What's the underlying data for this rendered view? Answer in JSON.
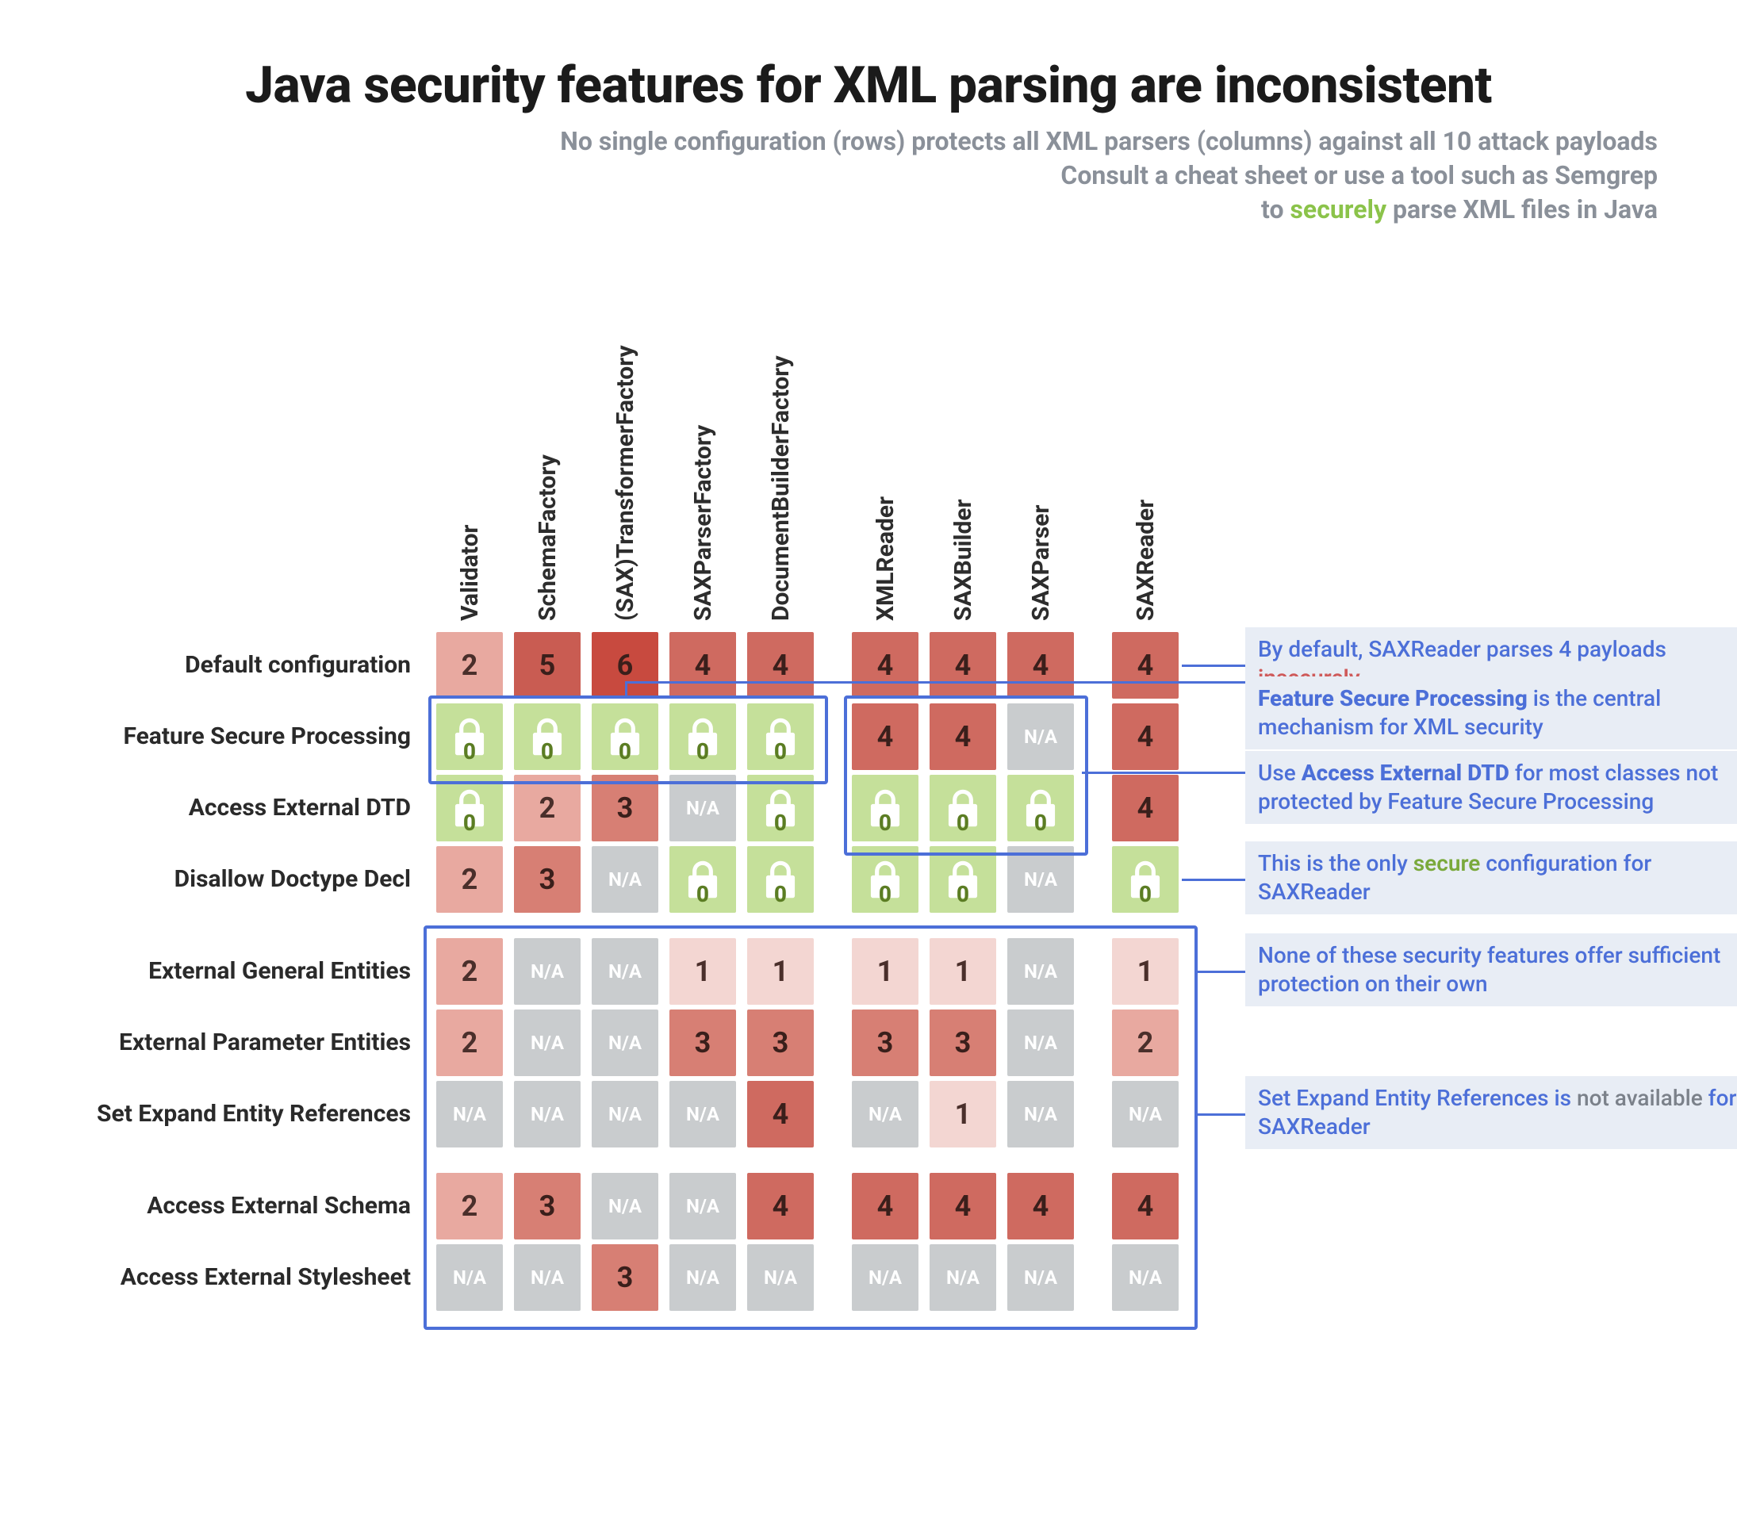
{
  "title": "Java security features for XML parsing are inconsistent",
  "subtitle_line1": "No single configuration (rows) protects all XML parsers (columns) against all 10 attack payloads",
  "subtitle_line2a": "Consult a cheat sheet or use a tool such as Semgrep",
  "subtitle_line3_pre": "to ",
  "subtitle_line3_sec": "securely",
  "subtitle_line3_post": " parse XML files in Java",
  "columns": [
    "Validator",
    "SchemaFactory",
    "(SAX)TransformerFactory",
    "SAXParserFactory",
    "DocumentBuilderFactory",
    "XMLReader",
    "SAXBuilder",
    "SAXParser",
    "SAXReader"
  ],
  "rows": [
    {
      "label": "Default configuration",
      "cells": [
        "2",
        "5",
        "6",
        "4",
        "4",
        "4",
        "4",
        "4",
        "4"
      ],
      "space_after": false
    },
    {
      "label": "Feature Secure Processing",
      "cells": [
        "lock",
        "lock",
        "lock",
        "lock",
        "lock",
        "4",
        "4",
        "N/A",
        "4"
      ],
      "space_after": false
    },
    {
      "label": "Access External DTD",
      "cells": [
        "lock",
        "2",
        "3",
        "N/A",
        "lock",
        "lock",
        "lock",
        "lock",
        "4"
      ],
      "space_after": false
    },
    {
      "label": "Disallow Doctype Decl",
      "cells": [
        "2",
        "3",
        "N/A",
        "lock",
        "lock",
        "lock",
        "lock",
        "N/A",
        "lock"
      ],
      "space_after": true
    },
    {
      "label": "External General Entities",
      "cells": [
        "2",
        "N/A",
        "N/A",
        "1",
        "1",
        "1",
        "1",
        "N/A",
        "1"
      ],
      "space_after": false
    },
    {
      "label": "External Parameter Entities",
      "cells": [
        "2",
        "N/A",
        "N/A",
        "3",
        "3",
        "3",
        "3",
        "N/A",
        "2"
      ],
      "space_after": false
    },
    {
      "label": "Set Expand Entity References",
      "cells": [
        "N/A",
        "N/A",
        "N/A",
        "N/A",
        "4",
        "N/A",
        "1",
        "N/A",
        "N/A"
      ],
      "space_after": true
    },
    {
      "label": "Access External Schema",
      "cells": [
        "2",
        "3",
        "N/A",
        "N/A",
        "4",
        "4",
        "4",
        "4",
        "4"
      ],
      "space_after": false
    },
    {
      "label": "Access External Stylesheet",
      "cells": [
        "N/A",
        "N/A",
        "3",
        "N/A",
        "N/A",
        "N/A",
        "N/A",
        "N/A",
        "N/A"
      ],
      "space_after": false
    }
  ],
  "annotations": {
    "a1_pre": "By default, SAXReader parses 4 payloads ",
    "a1_insec": "insecurely",
    "a2_b": "Feature Secure Processing",
    "a2_post": " is the central mechanism for XML security",
    "a3_pre": "Use ",
    "a3_b": "Access External DTD",
    "a3_post": " for most classes not protected by Feature Secure Processing",
    "a4_pre": "This is the only ",
    "a4_sec": "secure",
    "a4_post": " configuration for SAXReader",
    "a5": "None of these security features offer sufficient protection on their own",
    "a6_pre": "Set Expand Entity References is ",
    "a6_muted": "not available",
    "a6_post": " for SAXReader"
  },
  "colors": {
    "0": "#f3d6d2",
    "1": "#f3d6d2",
    "2": "#e8a9a0",
    "3": "#d77f74",
    "4": "#cf6a60",
    "5": "#c95c52",
    "6": "#c84a3f"
  }
}
